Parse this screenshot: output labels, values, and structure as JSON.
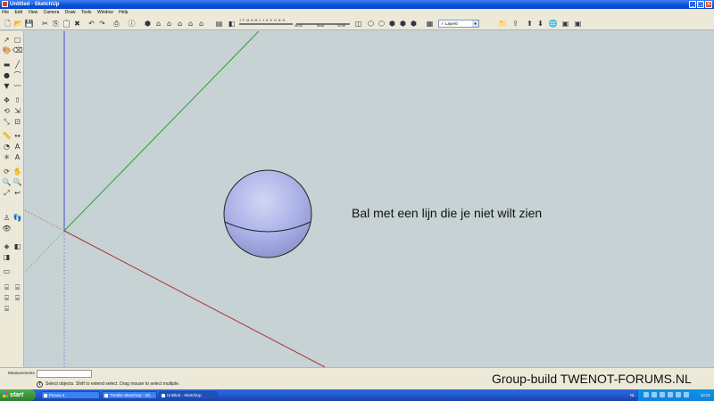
{
  "window": {
    "title": "Untitled - SketchUp"
  },
  "menu": [
    "File",
    "Edit",
    "View",
    "Camera",
    "Draw",
    "Tools",
    "Window",
    "Help"
  ],
  "shadow": {
    "months": "J F M A M J J A S O N D",
    "time_start": "06:43",
    "noon": "Noon",
    "time_end": "04:46"
  },
  "layer": {
    "selected": "Layer0"
  },
  "viewport": {
    "annotation": "Bal met een lijn die je niet wilt zien",
    "background": "#c7d2d5"
  },
  "measurements": {
    "label": "Measurements",
    "value": ""
  },
  "status": {
    "hint": "Select objects. Shift to extend select. Drag mouse to select multiple."
  },
  "watermark": "Group-build TWENOT-FORUMS.NL",
  "taskbar": {
    "start": "start",
    "tasks": [
      "Picasa 3",
      "Trimble SketchUp - Wi...",
      "Untitled - SketchUp"
    ],
    "lang": "NL",
    "clock": "10:21"
  },
  "colors": {
    "red_axis": "#b03030",
    "green_axis": "#2ea02e",
    "blue_axis": "#3040c0",
    "sphere": "#a9b0e8"
  },
  "icons": {
    "toolbar": [
      "new-icon",
      "open-icon",
      "save-icon",
      "cut-icon",
      "copy-icon",
      "paste-icon",
      "erase-icon",
      "undo-icon",
      "redo-icon",
      "print-icon",
      "model-info-icon",
      "iso-view-icon",
      "top-view-icon",
      "front-view-icon",
      "right-view-icon",
      "back-view-icon",
      "left-view-icon",
      "shadows-icon",
      "xray-icon",
      "wireframe-icon",
      "hidden-line-icon",
      "shaded-icon",
      "textured-icon",
      "monochrome-icon",
      "layer-manager-icon",
      "google-earth-icon",
      "warehouse-icon"
    ],
    "left": [
      "select-icon",
      "make-component-icon",
      "paint-bucket-icon",
      "eraser-icon",
      "rectangle-icon",
      "line-icon",
      "circle-icon",
      "arc-icon",
      "polygon-icon",
      "freehand-icon",
      "move-icon",
      "push-pull-icon",
      "rotate-icon",
      "follow-me-icon",
      "scale-icon",
      "offset-icon",
      "tape-measure-icon",
      "dimension-icon",
      "protractor-icon",
      "text-icon",
      "axes-icon",
      "3d-text-icon",
      "orbit-icon",
      "pan-icon",
      "zoom-icon",
      "zoom-window-icon",
      "zoom-extents-icon",
      "previous-view-icon",
      "position-camera-icon",
      "walk-icon",
      "look-around-icon",
      "section-plane-icon",
      "sandbox-icon"
    ]
  }
}
